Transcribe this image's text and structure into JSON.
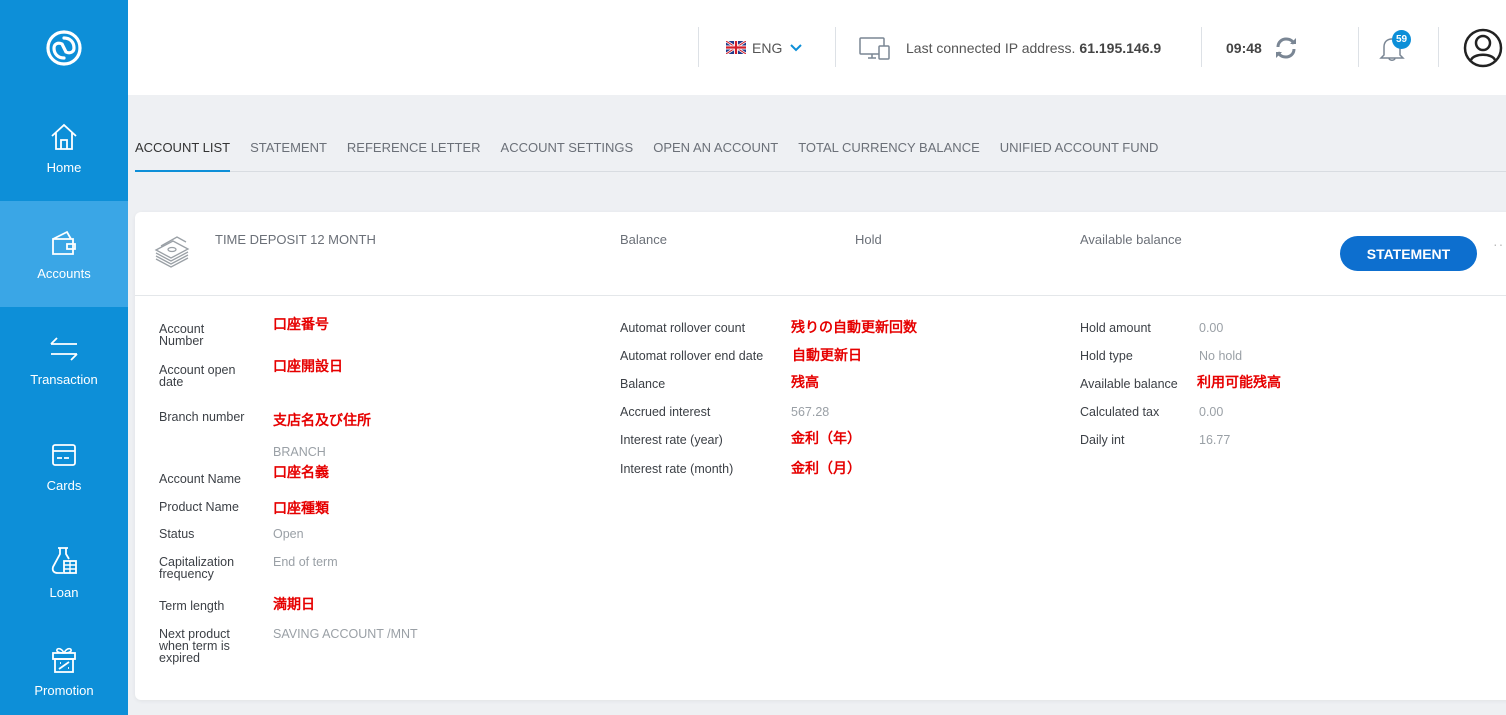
{
  "topbar": {
    "language": "ENG",
    "ip_label": "Last connected IP address.",
    "ip_value": "61.195.146.9",
    "time": "09:48",
    "notifications": "59"
  },
  "sidebar": {
    "items": [
      {
        "label": "Home",
        "icon": "home-icon"
      },
      {
        "label": "Accounts",
        "icon": "wallet-icon"
      },
      {
        "label": "Transaction",
        "icon": "transfer-arrows-icon"
      },
      {
        "label": "Cards",
        "icon": "card-icon"
      },
      {
        "label": "Loan",
        "icon": "loan-icon"
      },
      {
        "label": "Promotion",
        "icon": "gift-icon"
      }
    ]
  },
  "tabs": [
    "ACCOUNT LIST",
    "STATEMENT",
    "REFERENCE LETTER",
    "ACCOUNT SETTINGS",
    "OPEN AN ACCOUNT",
    "TOTAL CURRENCY BALANCE",
    "UNIFIED ACCOUNT FUND"
  ],
  "card": {
    "product": "TIME DEPOSIT 12 MONTH",
    "balance_label": "Balance",
    "hold_label": "Hold",
    "available_label": "Available balance",
    "statement_button": "STATEMENT",
    "more": "···"
  },
  "left": {
    "account_number": {
      "label": "Account Number",
      "value": "口座番号"
    },
    "open_date": {
      "label": "Account open date",
      "value": "口座開設日"
    },
    "branch_number": {
      "label": "Branch number",
      "value": "支店名及び住所",
      "sub": "BRANCH"
    },
    "account_name": {
      "label": "Account Name",
      "value": "口座名義"
    },
    "product_name": {
      "label": "Product Name",
      "value": "口座種類"
    },
    "status": {
      "label": "Status",
      "value": "Open"
    },
    "capitalization": {
      "label": "Capitalization frequency",
      "value": "End of term"
    },
    "term_length": {
      "label": "Term length",
      "value": "満期日"
    },
    "next_product": {
      "label": "Next product when term is expired",
      "value": "SAVING ACCOUNT /MNT"
    }
  },
  "middle": {
    "rollover_count": {
      "label": "Automat rollover count",
      "value": "残りの自動更新回数"
    },
    "rollover_end": {
      "label": "Automat rollover end date",
      "value": "自動更新日"
    },
    "balance": {
      "label": "Balance",
      "value": "残高"
    },
    "accrued": {
      "label": "Accrued interest",
      "value": "567.28"
    },
    "rate_year": {
      "label": "Interest rate (year)",
      "value": "金利（年）"
    },
    "rate_month": {
      "label": "Interest rate (month)",
      "value": "金利（月）"
    }
  },
  "right": {
    "hold_amount": {
      "label": "Hold amount",
      "value": "0.00"
    },
    "hold_type": {
      "label": "Hold type",
      "value": "No hold"
    },
    "available": {
      "label": "Available balance",
      "value": "利用可能残高"
    },
    "tax": {
      "label": "Calculated tax",
      "value": "0.00"
    },
    "daily": {
      "label": "Daily int",
      "value": "16.77"
    }
  }
}
